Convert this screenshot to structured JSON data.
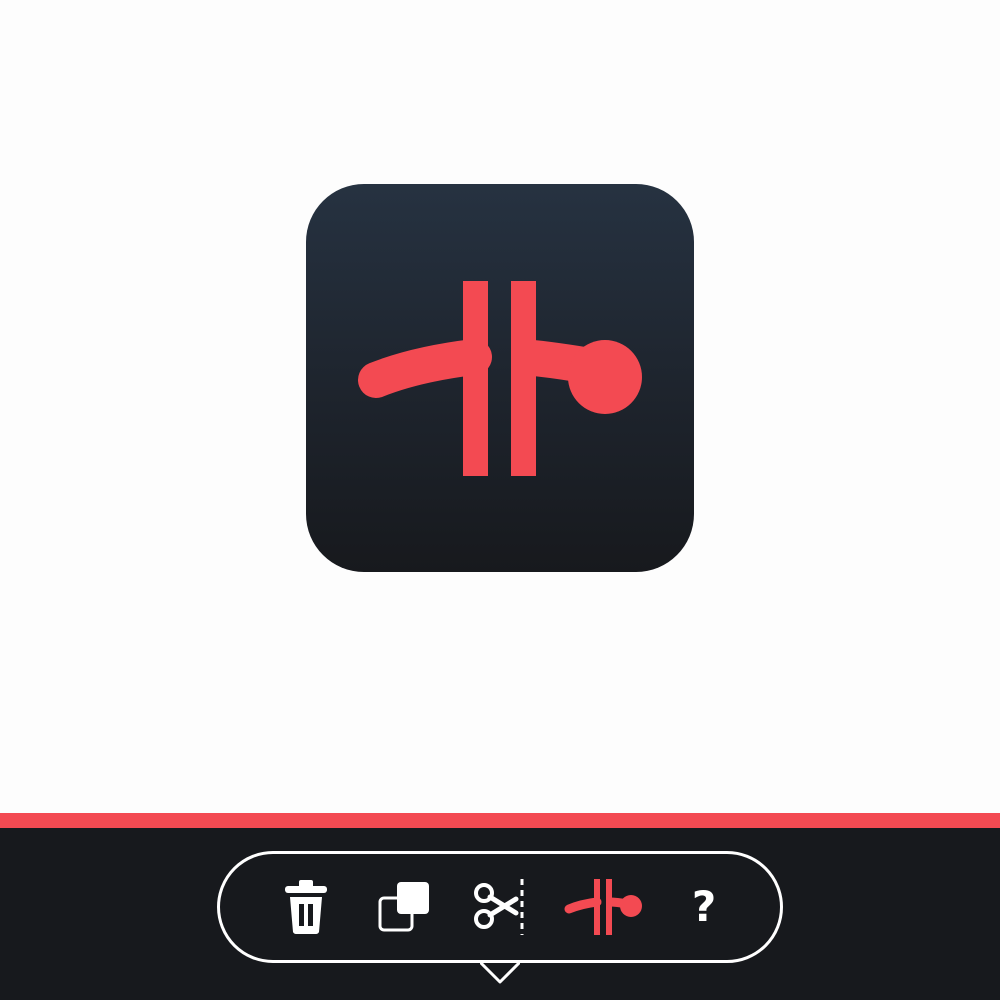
{
  "colors": {
    "accent": "#f34a52",
    "panel": "#17191d",
    "toolbar_outline": "#ffffff",
    "icon_foreground": "#ffffff"
  },
  "app_icon": {
    "icon": "capacitor-icon"
  },
  "toolbar": {
    "buttons": [
      {
        "id": "delete",
        "icon": "trash-icon"
      },
      {
        "id": "duplicate",
        "icon": "copy-icon"
      },
      {
        "id": "cut",
        "icon": "scissors-cut-icon"
      },
      {
        "id": "capacitor",
        "icon": "capacitor-icon",
        "active": true
      },
      {
        "id": "help",
        "icon": "question-mark-icon",
        "label": "?"
      }
    ]
  }
}
